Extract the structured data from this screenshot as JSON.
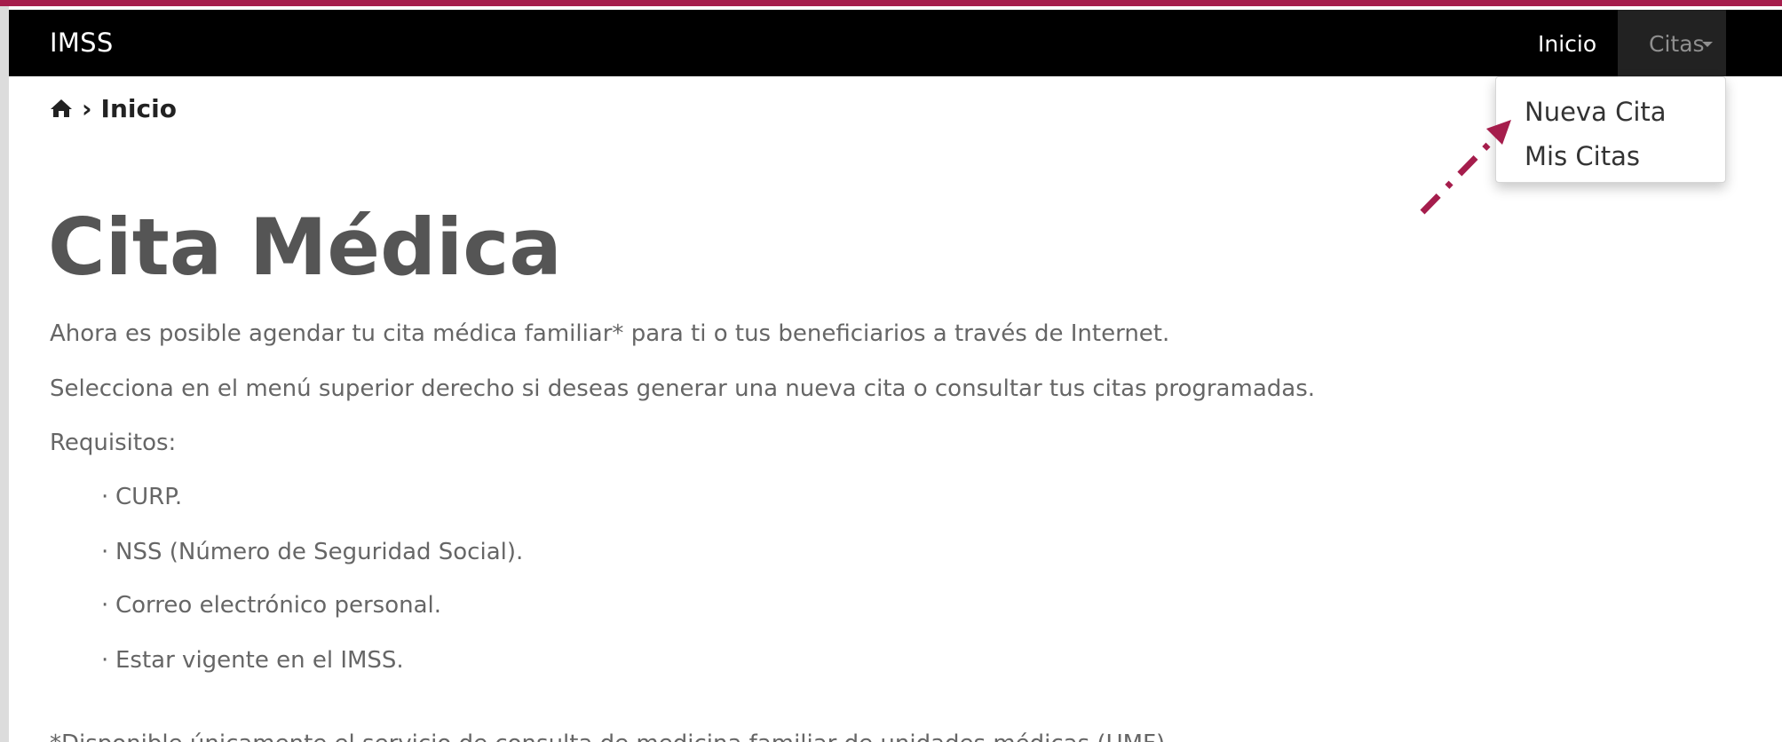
{
  "brand": "IMSS",
  "nav": {
    "inicio_label": "Inicio",
    "citas_label": "Citas"
  },
  "dropdown": {
    "items": [
      "Nueva Cita",
      "Mis Citas"
    ]
  },
  "breadcrumb": {
    "separator": "›",
    "current": "Inicio"
  },
  "main": {
    "title": "Cita Médica",
    "paragraphs": [
      "Ahora es posible agendar tu cita médica familiar* para ti o tus beneficiarios a través de Internet.",
      "Selecciona en el menú superior derecho si deseas generar una nueva cita o consultar tus citas programadas.",
      "Requisitos:"
    ],
    "requirements": [
      "CURP.",
      "NSS (Número de Seguridad Social).",
      "Correo electrónico personal.",
      "Estar vigente en el IMSS."
    ],
    "footnote": "*Disponible únicamente el servicio de consulta de medicina familiar de unidades médicas (UMF)."
  },
  "colors": {
    "accent": "#a51d4c",
    "navbar": "#000000",
    "arrow": "#a51d4c"
  }
}
